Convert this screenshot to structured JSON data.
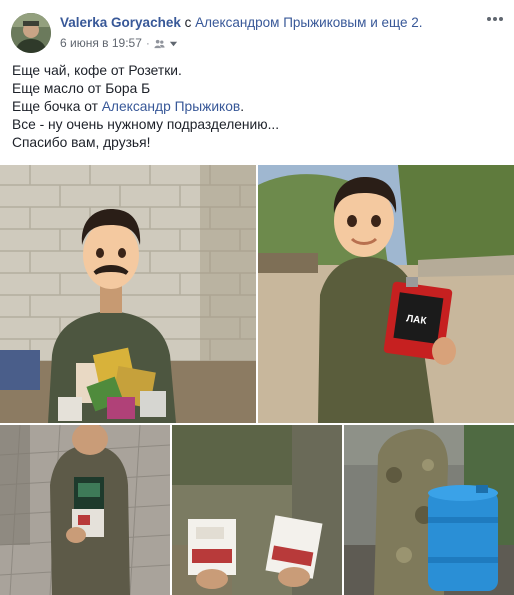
{
  "post": {
    "author": "Valerka Goryachek",
    "with_prefix": "с",
    "tagged": "Александром Прыжиковым",
    "and_more": "и еще 2.",
    "timestamp": "6 июня в 19:57",
    "separator": "·",
    "privacy_icon": "friends-icon",
    "audience_caret_icon": "chevron-down-icon",
    "options_icon": "more-horizontal-icon"
  },
  "text": {
    "line1": "Еще чай, кофе от Розетки.",
    "line2": "Еще масло от Бора Б",
    "line3_prefix": "Еще бочка от ",
    "line3_mention": "Александр Прыжиков",
    "line3_suffix": ".",
    "line4": "Все - ну очень нужному подразделению...",
    "line5": "Спасибо вам, друзья!"
  },
  "photos": {
    "count": 5,
    "ph2_can_label": "ЛАК"
  },
  "colors": {
    "link": "#385898",
    "text": "#1d2129",
    "meta": "#616770"
  }
}
